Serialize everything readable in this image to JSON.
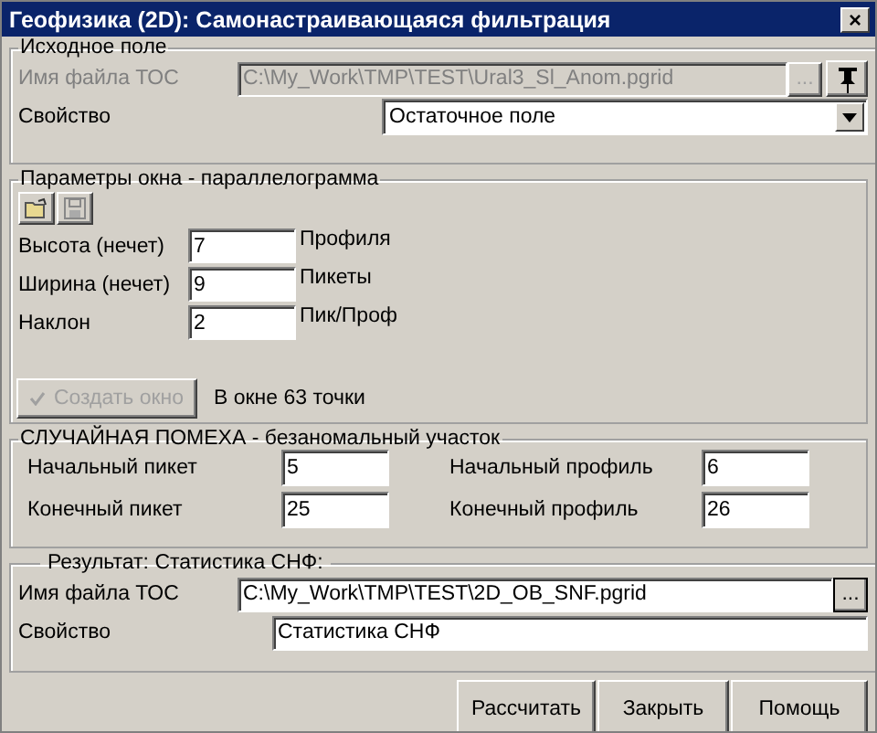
{
  "window": {
    "title": "Геофизика (2D): Самонастраивающаяся фильтрация",
    "close_label": "×"
  },
  "source": {
    "legend": "Исходное поле",
    "file": {
      "label": "Имя файла ТОС",
      "value": "C:\\My_Work\\TMP\\TEST\\Ural3_Sl_Anom.pgrid",
      "browse_label": "...",
      "disabled": true
    },
    "property": {
      "label": "Свойство",
      "value": "Остаточное поле"
    }
  },
  "window_params": {
    "legend": "Параметры окна - параллелограмма",
    "params": [
      {
        "label": "Высота (нечет)",
        "value": "7",
        "unit": "Профиля"
      },
      {
        "label": "Ширина (нечет)",
        "value": "9",
        "unit": "Пикеты"
      },
      {
        "label": "Наклон",
        "value": "2",
        "unit": "Пик/Проф"
      }
    ],
    "create_button": {
      "label": "Создать окно",
      "disabled": true
    },
    "points_text": "В окне 63 точки"
  },
  "noise": {
    "legend": "СЛУЧАЙНАЯ ПОМЕХА - безаномальный участок",
    "fields": [
      {
        "label": "Начальный пикет",
        "value": "5"
      },
      {
        "label": "Начальный профиль",
        "value": "6"
      },
      {
        "label": "Конечный пикет",
        "value": "25"
      },
      {
        "label": "Конечный профиль",
        "value": "26"
      }
    ]
  },
  "result": {
    "legend": "Результат: Статистика СНФ:",
    "file": {
      "label": "Имя файла ТОС",
      "value": "C:\\My_Work\\TMP\\TEST\\2D_OB_SNF.pgrid",
      "browse_label": "...",
      "disabled": false
    },
    "property": {
      "label": "Свойство",
      "value": "Статистика СНФ"
    }
  },
  "buttons": [
    "Рассчитать",
    "Закрыть",
    "Помощь"
  ]
}
